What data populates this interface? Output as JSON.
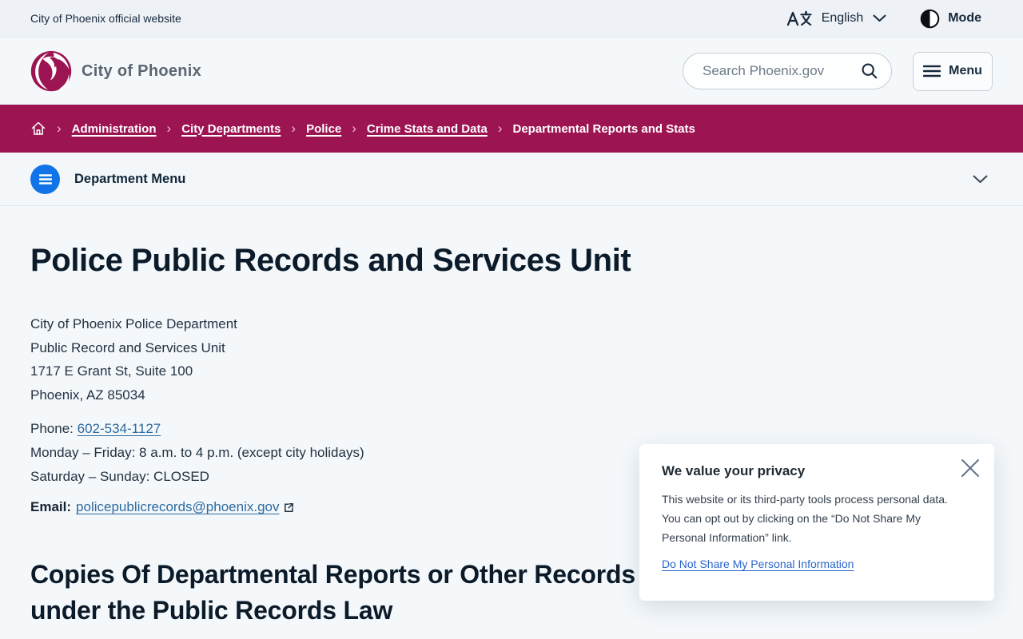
{
  "top_bar": {
    "site_label": "City of Phoenix official website",
    "language_label": "English",
    "mode_label": "Mode"
  },
  "header": {
    "brand": "City of Phoenix",
    "search_placeholder": "Search Phoenix.gov",
    "menu_label": "Menu"
  },
  "breadcrumb": {
    "items": [
      {
        "label": "Administration"
      },
      {
        "label": "City Departments"
      },
      {
        "label": "Police"
      },
      {
        "label": "Crime Stats and Data"
      },
      {
        "label": "Departmental Reports and Stats"
      }
    ]
  },
  "department_menu": {
    "label": "Department Menu"
  },
  "content": {
    "title": "Police Public Records and Services Unit",
    "address_lines": [
      "City of Phoenix Police Department",
      "Public Record and Services Unit",
      "1717 E Grant St, Suite 100",
      "Phoenix, AZ 85034"
    ],
    "phone_label": "Phone:",
    "phone_number": "602-534-1127",
    "hours_line1": "Monday – Friday: 8 a.m. to 4 p.m. (except city holidays)",
    "hours_line2": "Saturday – Sunday: CLOSED",
    "email_label": "Email:",
    "email": "policepublicrecords@phoenix.gov",
    "section_title_line1": "Copies Of Departmental Reports or Other Records",
    "section_title_line2": "under the Public Records Law"
  },
  "privacy_dialog": {
    "title": "We value your privacy",
    "body": "This website or its third-party tools process personal data. You can opt out by clicking on the “Do Not Share My Personal Information” link.",
    "link_label": "Do Not Share My Personal Information"
  },
  "colors": {
    "brand_magenta": "#9D1452",
    "accent_blue": "#1173E8",
    "link_blue": "#2D6A9F",
    "dialog_link_blue": "#2B66C9"
  }
}
